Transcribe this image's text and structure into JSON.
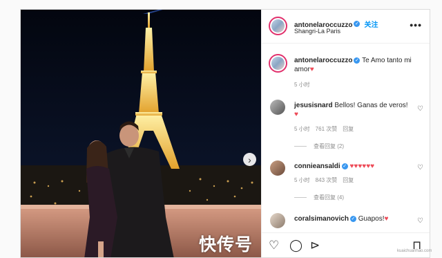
{
  "header": {
    "username": "antonelaroccuzzo",
    "follow_label": "关注",
    "location": "Shangri-La Paris",
    "more_label": "•••"
  },
  "caption": {
    "username": "antonelaroccuzzo",
    "text": "Te Amo tanto mi amor",
    "time": "5 小时"
  },
  "comments": [
    {
      "username": "jesusisnard",
      "text": "Bellos! Ganas de veros!",
      "time": "5 小时",
      "likes": "761 次赞",
      "reply": "回复",
      "view_replies": "查看回复 (2)"
    },
    {
      "username": "connieansaldi",
      "text": "",
      "time": "5 小时",
      "likes": "843 次赞",
      "reply": "回复",
      "view_replies": "查看回复 (4)"
    },
    {
      "username": "coralsimanovich",
      "text": "Guapos!"
    }
  ],
  "icons": {
    "heart": "♡",
    "comment": "◯",
    "share": "⊳",
    "save": "⊓",
    "next": "›",
    "heart_red": "♥"
  },
  "watermark": {
    "main": "快传号",
    "sub": "kuaichuanhao.com"
  },
  "colors": {
    "accent_blue": "#0095f6",
    "heart_red": "#ed4956",
    "verified_blue": "#3897f0"
  }
}
